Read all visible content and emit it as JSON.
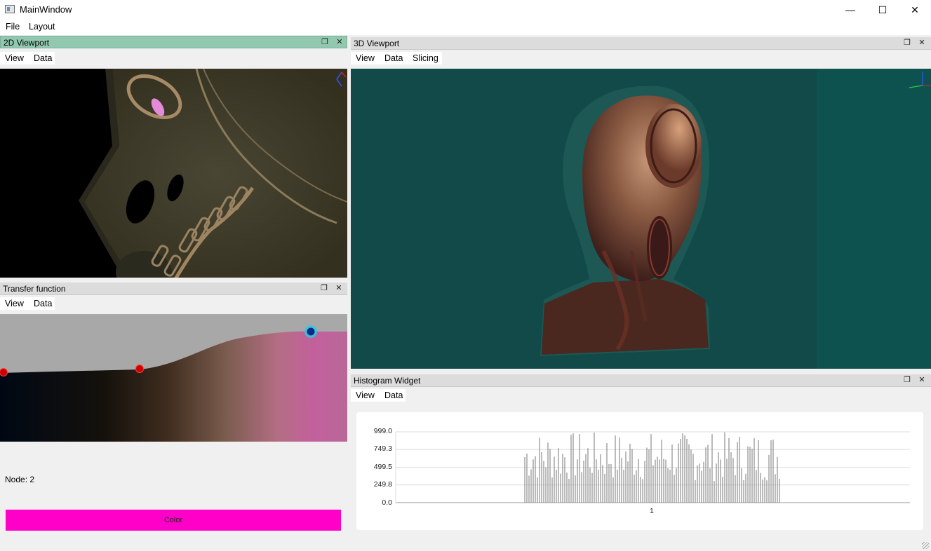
{
  "window": {
    "title": "MainWindow",
    "minimize_glyph": "—",
    "maximize_glyph": "☐",
    "close_glyph": "✕"
  },
  "menubar": {
    "items": [
      "File",
      "Layout"
    ]
  },
  "viewport2d": {
    "title": "2D Viewport",
    "tabs": [
      "View",
      "Data"
    ],
    "float_glyph": "❐",
    "close_glyph": "✕"
  },
  "viewport3d": {
    "title": "3D Viewport",
    "tabs": [
      "View",
      "Data",
      "Slicing"
    ],
    "float_glyph": "❐",
    "close_glyph": "✕"
  },
  "transfer": {
    "title": "Transfer function",
    "tabs": [
      "View",
      "Data"
    ],
    "node_label": "Node: 2",
    "color_button": "Color",
    "float_glyph": "❐",
    "close_glyph": "✕",
    "colors": {
      "accent": "#ff00c8",
      "curve_bg": "#a8a8a8",
      "node": "#cc0000",
      "selected_node": "#0a2a8a"
    }
  },
  "histogram": {
    "title": "Histogram Widget",
    "tabs": [
      "View",
      "Data"
    ],
    "float_glyph": "❐",
    "close_glyph": "✕",
    "chart_data": {
      "type": "bar",
      "yticks": [
        "999.0",
        "749.3",
        "499.5",
        "249.8",
        "0.0"
      ],
      "ylim": [
        0,
        999
      ],
      "xtick": "1"
    }
  }
}
